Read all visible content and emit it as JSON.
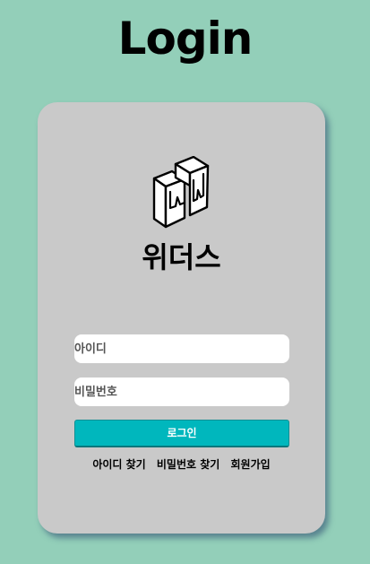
{
  "page": {
    "title": "Login"
  },
  "brand": {
    "name": "위더스",
    "logo_icon": "withus-w-box-logo-icon"
  },
  "form": {
    "id_input": {
      "placeholder": "아이디",
      "value": ""
    },
    "password_input": {
      "placeholder": "비밀번호",
      "value": ""
    },
    "login_button_label": "로그인"
  },
  "links": {
    "find_id": "아이디 찾기",
    "find_password": "비밀번호 찾기",
    "sign_up": "회원가입"
  },
  "colors": {
    "background": "#93cfb9",
    "card": "#c9c9c9",
    "login_button": "#00b7bd",
    "input_background": "#ffffff"
  }
}
